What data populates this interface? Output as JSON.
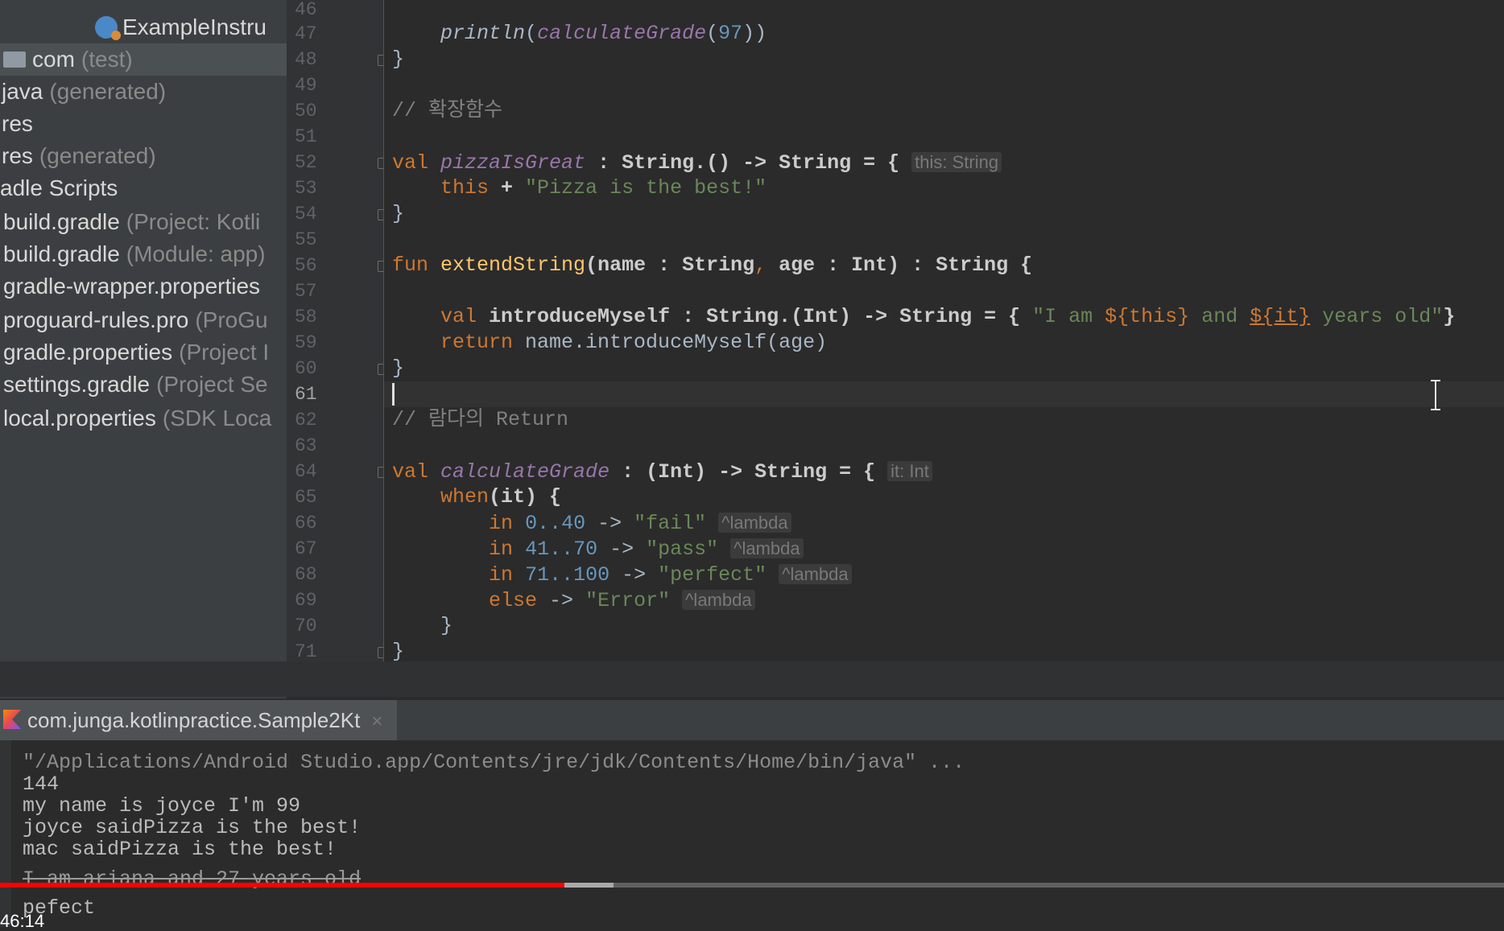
{
  "project_tree": {
    "items": [
      {
        "name": "ExampleInstru",
        "sub": "",
        "icon": "class-icon"
      },
      {
        "name": "com",
        "sub": "(test)",
        "icon": "folder-icon"
      },
      {
        "name": "java",
        "sub": "(generated)",
        "icon": ""
      },
      {
        "name": "res",
        "sub": "",
        "icon": ""
      },
      {
        "name": "res",
        "sub": "(generated)",
        "icon": ""
      },
      {
        "name": "adle Scripts",
        "sub": "",
        "icon": ""
      },
      {
        "name": "build.gradle",
        "sub": "(Project: Kotli",
        "icon": ""
      },
      {
        "name": "build.gradle",
        "sub": "(Module: app)",
        "icon": ""
      },
      {
        "name": "gradle-wrapper.properties",
        "sub": "",
        "icon": ""
      },
      {
        "name": "proguard-rules.pro",
        "sub": "(ProGu",
        "icon": ""
      },
      {
        "name": "gradle.properties",
        "sub": "(Project I",
        "icon": ""
      },
      {
        "name": "settings.gradle",
        "sub": "(Project Se",
        "icon": ""
      },
      {
        "name": "local.properties",
        "sub": "(SDK Loca",
        "icon": ""
      }
    ]
  },
  "editor": {
    "line_numbers": [
      "46",
      "47",
      "48",
      "49",
      "50",
      "51",
      "52",
      "53",
      "54",
      "55",
      "56",
      "57",
      "58",
      "59",
      "60",
      "61",
      "62",
      "63",
      "64",
      "65",
      "66",
      "67",
      "68",
      "69",
      "70",
      "71"
    ],
    "current_line": "61",
    "code": {
      "l47_fn": "println",
      "l47_call": "calculateGrade",
      "l47_arg": "97",
      "l48": "}",
      "l50_comment": "// 확장함수",
      "l52_kw": "val",
      "l52_name": "pizzaIsGreat",
      "l52_rest": " : String.() -> String = {",
      "l52_hint": "this: String",
      "l53_kw": "this",
      "l53_op": " + ",
      "l53_str": "\"Pizza is the best!\"",
      "l54": "}",
      "l56_kw": "fun",
      "l56_name": "extendString",
      "l56_rest1": "(name : String",
      "l56_comma": ",",
      "l56_rest2": " age : Int) : String {",
      "l58_kw": "val",
      "l58_rest": " introduceMyself : String.(Int) -> String = { ",
      "l58_str1": "\"I am ",
      "l58_tmpl1": "${this}",
      "l58_str2": " and ",
      "l58_tmpl2": "${it}",
      "l58_str3": " years old\"",
      "l58_close": "}",
      "l59_kw": "return",
      "l59_rest": " name.introduceMyself(age)",
      "l60": "}",
      "l62_comment": "// 람다의 Return",
      "l64_kw": "val",
      "l64_name": "calculateGrade",
      "l64_rest": " : (Int) -> String = {",
      "l64_hint": "it: Int",
      "l65_kw": "when",
      "l65_rest": "(it) {",
      "l66_kw": "in",
      "l66_range": "0..40",
      "l66_arrow": " -> ",
      "l66_str": "\"fail\"",
      "l67_kw": "in",
      "l67_range": "41..70",
      "l67_arrow": " -> ",
      "l67_str": "\"pass\"",
      "l68_kw": "in",
      "l68_range": "71..100",
      "l68_arrow": " -> ",
      "l68_str": "\"perfect\"",
      "l69_kw": "else",
      "l69_arrow": " -> ",
      "l69_str": "\"Error\"",
      "lambda_hint": "^lambda",
      "l70": "}",
      "l71": "}"
    }
  },
  "run_panel": {
    "tab_label": "com.junga.kotlinpractice.Sample2Kt",
    "close_glyph": "×",
    "output": [
      "\"/Applications/Android Studio.app/Contents/jre/jdk/Contents/Home/bin/java\" ...",
      "144",
      "my name is joyce I'm 99",
      "joyce saidPizza is the best!",
      "mac saidPizza is the best!",
      "I am ariana and 27 years old",
      "pefect"
    ]
  },
  "video": {
    "timestamp": "46:14",
    "played_fraction": 0.375,
    "buffered_fraction": 0.408,
    "played_color": "#ff0000"
  }
}
